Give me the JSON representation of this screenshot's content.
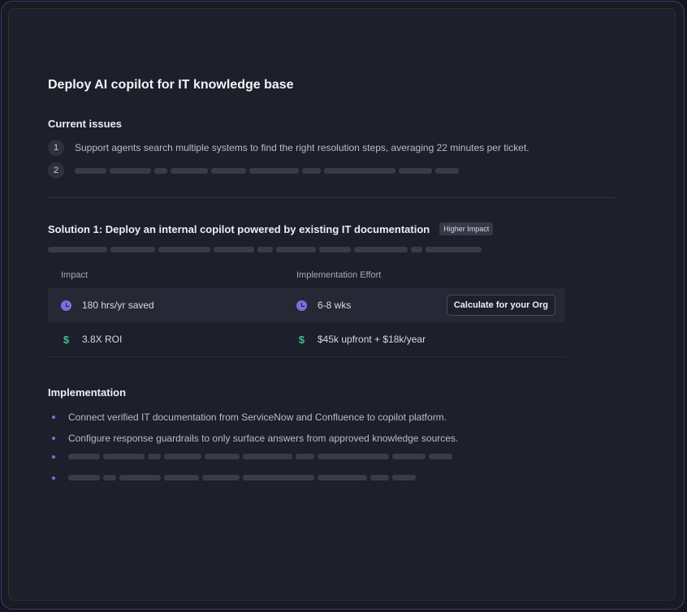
{
  "title": "Deploy AI copilot for IT knowledge base",
  "issues": {
    "heading": "Current issues",
    "items": [
      {
        "number": "1",
        "text": "Support agents search multiple systems to find the right resolution steps, averaging 22 minutes per ticket."
      },
      {
        "number": "2",
        "text": ""
      }
    ]
  },
  "solution": {
    "title": "Solution 1: Deploy an internal copilot powered by existing IT documentation",
    "badge": "Higher Impact",
    "table": {
      "headers": [
        "Impact",
        "Implementation Effort"
      ],
      "rows": [
        {
          "impact": "180 hrs/yr saved",
          "impact_icon": "clock-icon",
          "effort": "6-8 wks",
          "effort_icon": "clock-icon"
        },
        {
          "impact": "3.8X ROI",
          "impact_icon": "money-bag-icon",
          "effort": "$45k upfront + $18k/year",
          "effort_icon": "money-bag-icon"
        }
      ],
      "action_label": "Calculate for your Org"
    }
  },
  "implementation": {
    "heading": "Implementation",
    "items": [
      "Connect verified IT documentation from ServiceNow and Confluence to copilot platform.",
      "Configure response guardrails to only surface answers from approved knowledge sources.",
      "",
      ""
    ]
  },
  "colors": {
    "accent": "#7a6fe0",
    "money": "#3fbf8c",
    "background": "#1d1f2a"
  }
}
